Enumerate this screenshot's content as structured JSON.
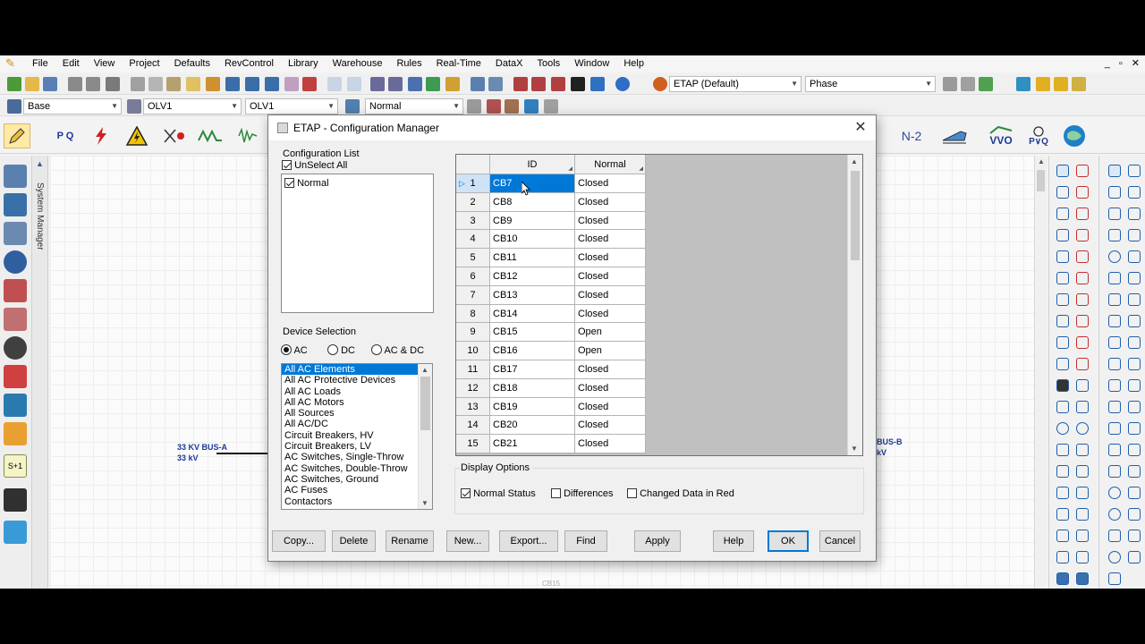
{
  "menu": [
    "File",
    "Edit",
    "View",
    "Project",
    "Defaults",
    "RevControl",
    "Library",
    "Warehouse",
    "Rules",
    "Real-Time",
    "DataX",
    "Tools",
    "Window",
    "Help"
  ],
  "window_controls": [
    "_",
    "▫",
    "✕"
  ],
  "toolbar": {
    "preset_label": "ETAP (Default)",
    "phase_label": "Phase",
    "base_label": "Base",
    "olv_1": "OLV1",
    "olv_2": "OLV1",
    "config_label": "Normal"
  },
  "ribbon": {
    "n2_label": "N-2",
    "vvo_label": "VVO",
    "pvq_label": "P∨Q",
    "pq_label": "P Q"
  },
  "sidebar": {
    "system_manager": "System Manager",
    "s1_label": "S+1"
  },
  "canvas": {
    "bus_a_name": "33 KV BUS-A",
    "bus_a_kv": "33 kV",
    "bus_b_name": "BUS-B",
    "bus_b_kv": "kV",
    "cb15_label": "CB15"
  },
  "dialog": {
    "title": "ETAP - Configuration Manager",
    "close": "✕",
    "config_list_label": "Configuration List",
    "unselect_all": "UnSelect All",
    "configurations": [
      "Normal"
    ],
    "device_selection_label": "Device Selection",
    "radio_ac": "AC",
    "radio_dc": "DC",
    "radio_acdc": "AC & DC",
    "devices": [
      "All AC Elements",
      "All AC Protective Devices",
      "All AC Loads",
      "All AC Motors",
      "All Sources",
      "All AC/DC",
      "Circuit Breakers, HV",
      "Circuit Breakers, LV",
      "AC Switches, Single-Throw",
      "AC Switches, Double-Throw",
      "AC Switches, Ground",
      "AC Fuses",
      "Contactors"
    ],
    "grid": {
      "col_id": "ID",
      "col_status": "Normal",
      "rows": [
        {
          "n": "1",
          "id": "CB7",
          "status": "Closed"
        },
        {
          "n": "2",
          "id": "CB8",
          "status": "Closed"
        },
        {
          "n": "3",
          "id": "CB9",
          "status": "Closed"
        },
        {
          "n": "4",
          "id": "CB10",
          "status": "Closed"
        },
        {
          "n": "5",
          "id": "CB11",
          "status": "Closed"
        },
        {
          "n": "6",
          "id": "CB12",
          "status": "Closed"
        },
        {
          "n": "7",
          "id": "CB13",
          "status": "Closed"
        },
        {
          "n": "8",
          "id": "CB14",
          "status": "Closed"
        },
        {
          "n": "9",
          "id": "CB15",
          "status": "Open"
        },
        {
          "n": "10",
          "id": "CB16",
          "status": "Open"
        },
        {
          "n": "11",
          "id": "CB17",
          "status": "Closed"
        },
        {
          "n": "12",
          "id": "CB18",
          "status": "Closed"
        },
        {
          "n": "13",
          "id": "CB19",
          "status": "Closed"
        },
        {
          "n": "14",
          "id": "CB20",
          "status": "Closed"
        },
        {
          "n": "15",
          "id": "CB21",
          "status": "Closed"
        }
      ]
    },
    "display_options_label": "Display Options",
    "opt_normal_status": "Normal Status",
    "opt_differences": "Differences",
    "opt_changed_red": "Changed Data in Red",
    "buttons": {
      "copy": "Copy...",
      "delete": "Delete",
      "rename": "Rename",
      "new": "New...",
      "export": "Export...",
      "find": "Find",
      "apply": "Apply",
      "help": "Help",
      "ok": "OK",
      "cancel": "Cancel"
    }
  },
  "colors": {
    "accent": "#0078d7",
    "bus_label": "#1a3a9a",
    "dialog_bg": "#f0f0f0"
  }
}
